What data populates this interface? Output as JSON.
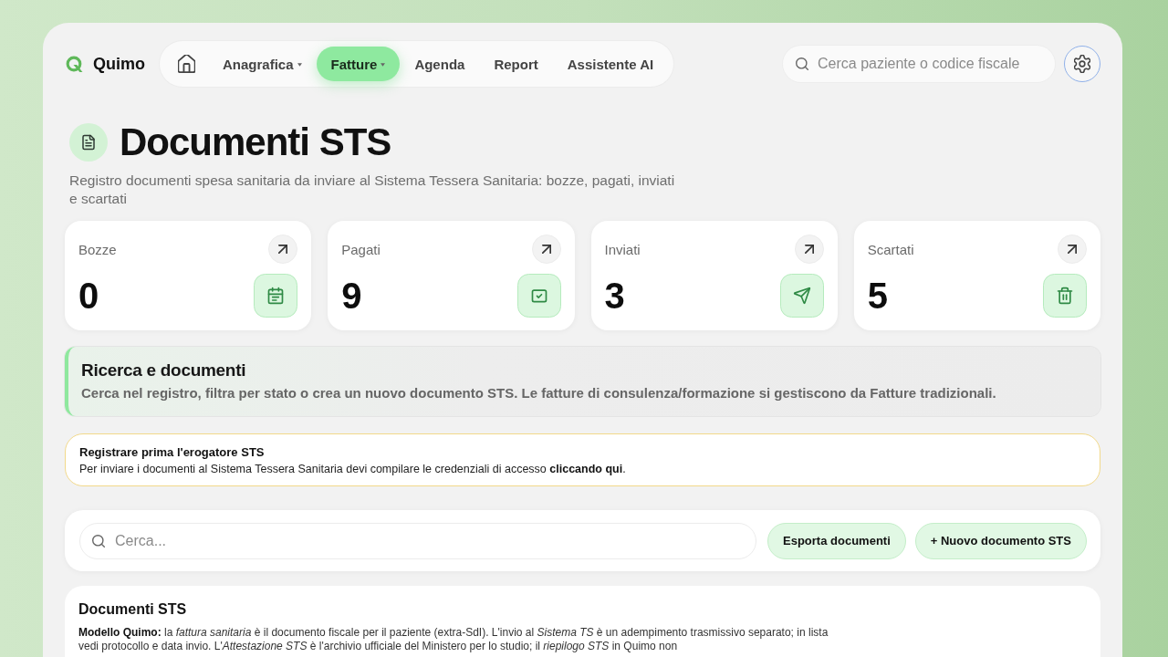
{
  "brand": {
    "name": "Quimo"
  },
  "nav": {
    "tabs": [
      {
        "kind": "home",
        "selected": false
      },
      {
        "kind": "menu",
        "label": "Anagrafica",
        "selected": false
      },
      {
        "kind": "menu",
        "label": "Fatture",
        "selected": true
      },
      {
        "kind": "link",
        "label": "Agenda",
        "selected": false
      },
      {
        "kind": "link",
        "label": "Report",
        "selected": false
      },
      {
        "kind": "link",
        "label": "Assistente AI",
        "selected": false
      }
    ]
  },
  "search": {
    "placeholder": "Cerca paziente o codice fiscale"
  },
  "page": {
    "title": "Documenti STS",
    "subtitle": "Registro documenti spesa sanitaria da inviare al Sistema Tessera Sanitaria: bozze, pagati, inviati e scartati"
  },
  "stats": [
    {
      "kind": "drafts",
      "label": "Bozze",
      "value": "0"
    },
    {
      "kind": "paid",
      "label": "Pagati",
      "value": "9"
    },
    {
      "kind": "sent",
      "label": "Inviati",
      "value": "3"
    },
    {
      "kind": "discarded",
      "label": "Scartati",
      "value": "5"
    }
  ],
  "section": {
    "title": "Ricerca e documenti",
    "text": "Cerca nel registro, filtra per stato o crea un nuovo documento STS. Le fatture di consulenza/formazione si gestiscono da Fatture tradizionali."
  },
  "notice": {
    "title": "Registrare prima l'erogatore STS",
    "text_before": "Per inviare i documenti al Sistema Tessera Sanitaria devi compilare le credenziali di accesso",
    "link": "cliccando qui",
    "text_after": "."
  },
  "toolbar": {
    "search": {
      "placeholder": "Cerca..."
    },
    "buttons": [
      {
        "label": "Esporta documenti"
      },
      {
        "label": "+ Nuovo documento STS"
      }
    ]
  },
  "documents": {
    "title": "Documenti STS",
    "note": "**Modello Quimo:** la *fattura sanitaria* è il documento fiscale per il paziente (extra-SdI). L'invio al *Sistema TS* è un adempimento trasmissivo separato; in lista vedi protocollo e data invio. L'*Attestazione STS* è l'archivio ufficiale del Ministero per lo studio; il *riepilogo STS* in Quimo non"
  }
}
